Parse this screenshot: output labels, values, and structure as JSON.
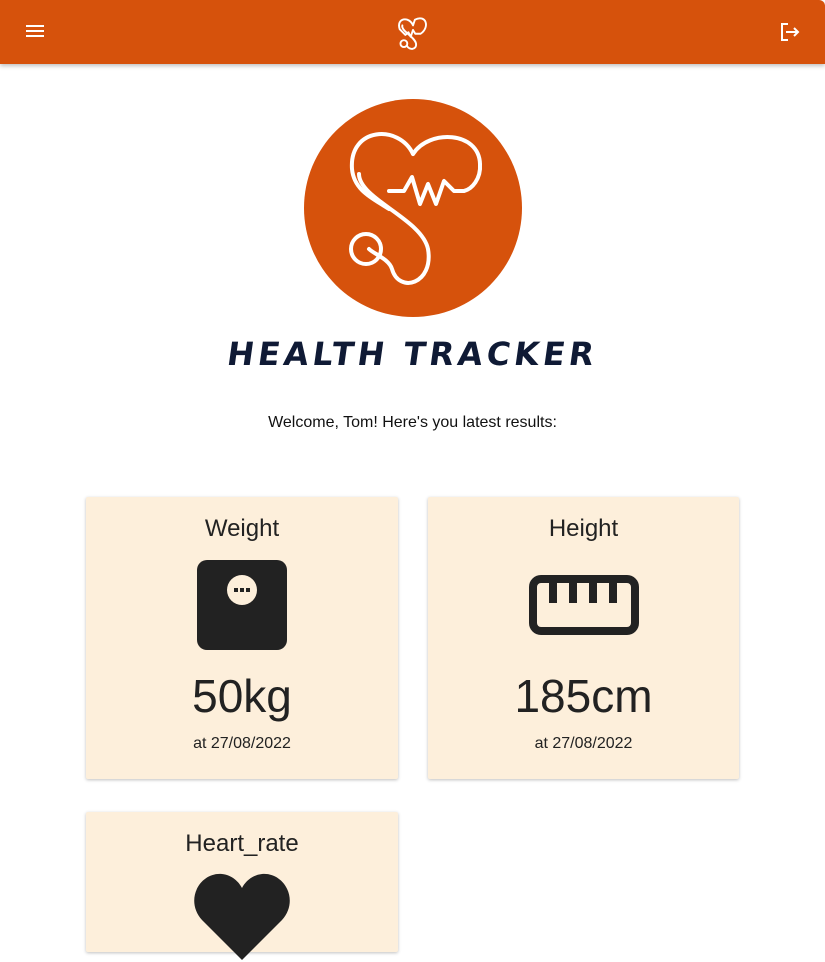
{
  "appbar": {
    "menu_icon": "menu-icon",
    "logo_icon": "heart-stethoscope-logo-icon",
    "logout_icon": "logout-icon",
    "background_color": "#d6520c"
  },
  "brand": {
    "title": "HEALTH TRACKER",
    "logo_color": "#d6520c"
  },
  "welcome_text": "Welcome, Tom! Here's you latest results:",
  "cards": [
    {
      "title": "Weight",
      "icon": "scale-icon",
      "value": "50kg",
      "date": "at 27/08/2022"
    },
    {
      "title": "Height",
      "icon": "ruler-icon",
      "value": "185cm",
      "date": "at 27/08/2022"
    },
    {
      "title": "Heart_rate",
      "icon": "heart-icon"
    }
  ],
  "colors": {
    "card_background": "#fdefdb",
    "brand_dark": "#0f1a35"
  }
}
